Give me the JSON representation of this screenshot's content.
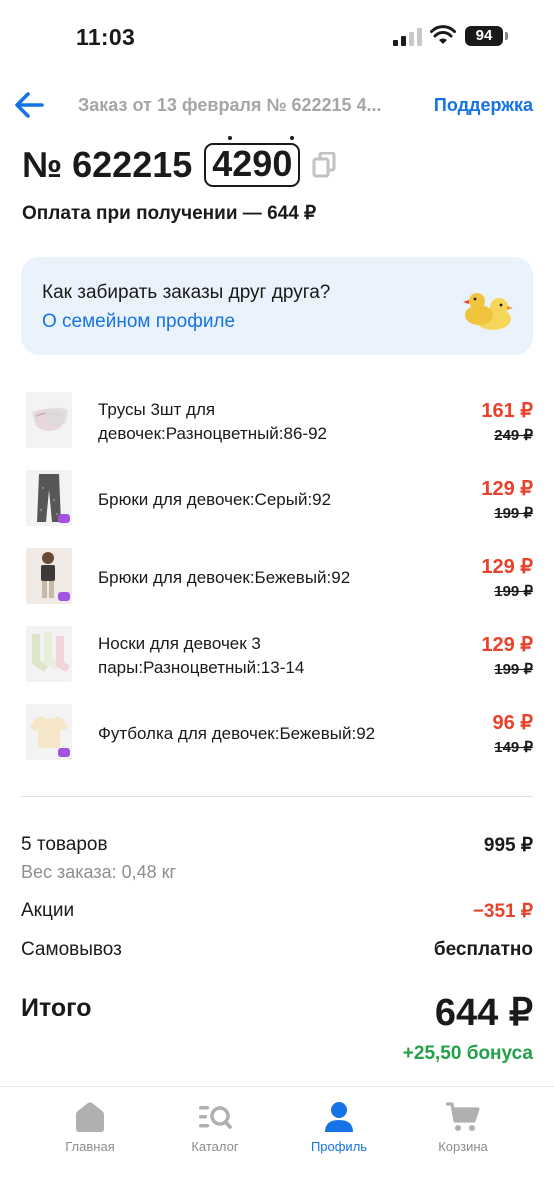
{
  "status_bar": {
    "time": "11:03",
    "battery": "94"
  },
  "nav": {
    "title": "Заказ от 13 февраля № 622215 4...",
    "support_label": "Поддержка"
  },
  "order": {
    "number_label": "№ 622215",
    "code": "4290",
    "payment": "Оплата при получении — 644 ₽"
  },
  "banner": {
    "title": "Как забирать заказы друг друга?",
    "link": "О семейном профиле"
  },
  "items": [
    {
      "name": "Трусы 3шт для девочек:Разноцветный:86-92",
      "price": "161 ₽",
      "old_price": "249 ₽"
    },
    {
      "name": "Брюки для девочек:Серый:92",
      "price": "129 ₽",
      "old_price": "199 ₽"
    },
    {
      "name": "Брюки для девочек:Бежевый:92",
      "price": "129 ₽",
      "old_price": "199 ₽"
    },
    {
      "name": "Носки для девочек 3 пары:Разноцветный:13-14",
      "price": "129 ₽",
      "old_price": "199 ₽"
    },
    {
      "name": "Футболка для девочек:Бежевый:92",
      "price": "96 ₽",
      "old_price": "149 ₽"
    }
  ],
  "summary": {
    "count_label": "5 товаров",
    "count_value": "995 ₽",
    "weight": "Вес заказа: 0,48 кг",
    "promo_label": "Акции",
    "promo_value": "−351 ₽",
    "pickup_label": "Самовывоз",
    "pickup_value": "бесплатно",
    "total_label": "Итого",
    "total_value": "644 ₽",
    "bonus": "+25,50 бонуса"
  },
  "tabbar": {
    "home": "Главная",
    "catalog": "Каталог",
    "profile": "Профиль",
    "cart": "Корзина"
  },
  "colors": {
    "accent": "#1673e6",
    "price_red": "#e8412c",
    "bonus_green": "#22a04a",
    "banner_bg": "#eaf3fb"
  }
}
